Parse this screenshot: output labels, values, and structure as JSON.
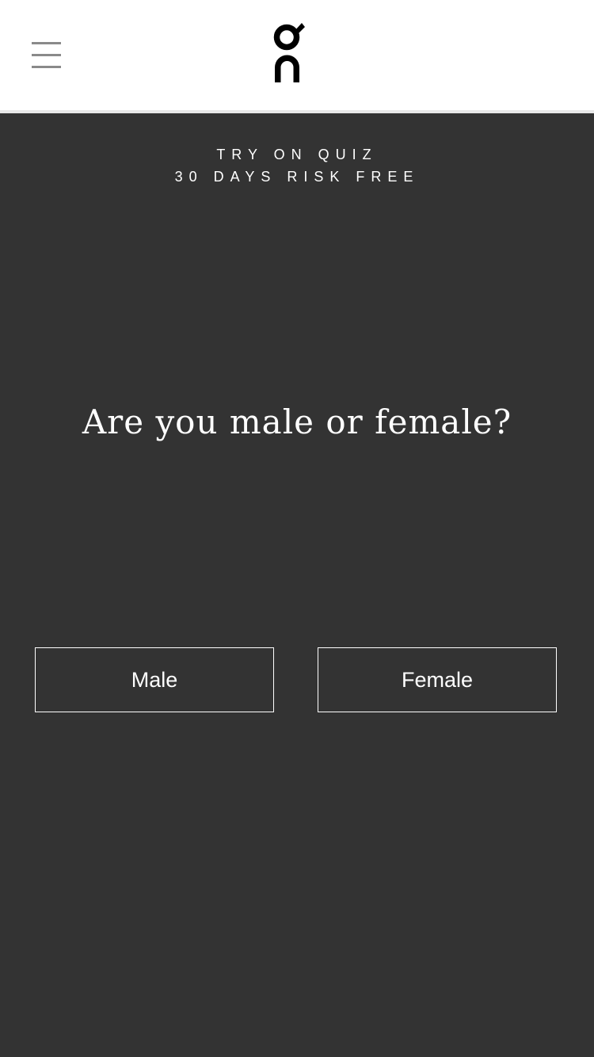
{
  "header": {
    "menu_icon": "hamburger-menu-icon",
    "logo_icon": "on-brand-logo"
  },
  "main": {
    "kicker_line1": "TRY ON QUIZ",
    "kicker_line2": "30 DAYS RISK FREE",
    "question": "Are you male or female?",
    "options": [
      {
        "label": "Male"
      },
      {
        "label": "Female"
      }
    ]
  },
  "colors": {
    "header_bg": "#ffffff",
    "page_bg": "#333333",
    "text": "#ffffff",
    "menu_icon": "#8a8a8a",
    "logo": "#000000"
  }
}
